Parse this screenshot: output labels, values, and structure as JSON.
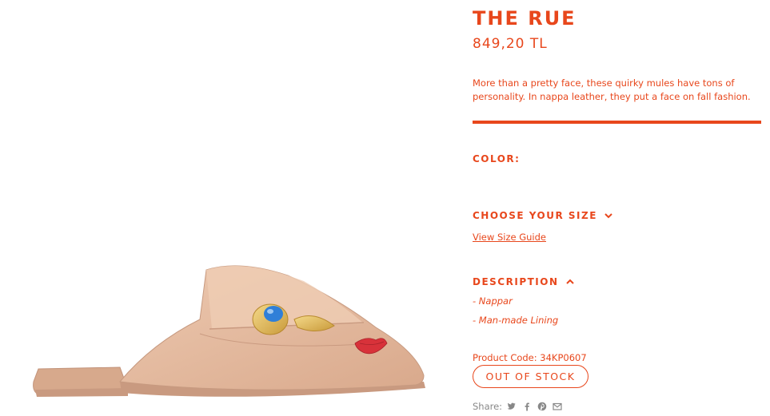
{
  "product": {
    "title": "THE RUE",
    "price": "849,20 TL",
    "description": "More than a pretty face, these quirky mules have tons of personality. In nappa leather, they put a face on fall fashion.",
    "image_alt": "Nude leather mule with blue eye and red lips embellishments"
  },
  "color": {
    "label": "COLOR:"
  },
  "size": {
    "label": "CHOOSE YOUR SIZE",
    "toggle_icon": "chevron-down-icon",
    "guide_link": "View Size Guide"
  },
  "details": {
    "label": "DESCRIPTION",
    "toggle_icon": "chevron-up-icon",
    "items": [
      "- Nappar",
      "- Man-made Lining"
    ]
  },
  "product_code": "Product Code: 34KP0607",
  "stock_button": "OUT OF STOCK",
  "share": {
    "label": "Share:",
    "icons": [
      "twitter-icon",
      "facebook-icon",
      "pinterest-icon",
      "email-icon"
    ]
  },
  "colors": {
    "accent": "#e8471c",
    "shoe_leather": "#e8c0a6",
    "eye_blue": "#2f7fd8",
    "lips_red": "#d8323a",
    "gold": "#e2b552"
  }
}
